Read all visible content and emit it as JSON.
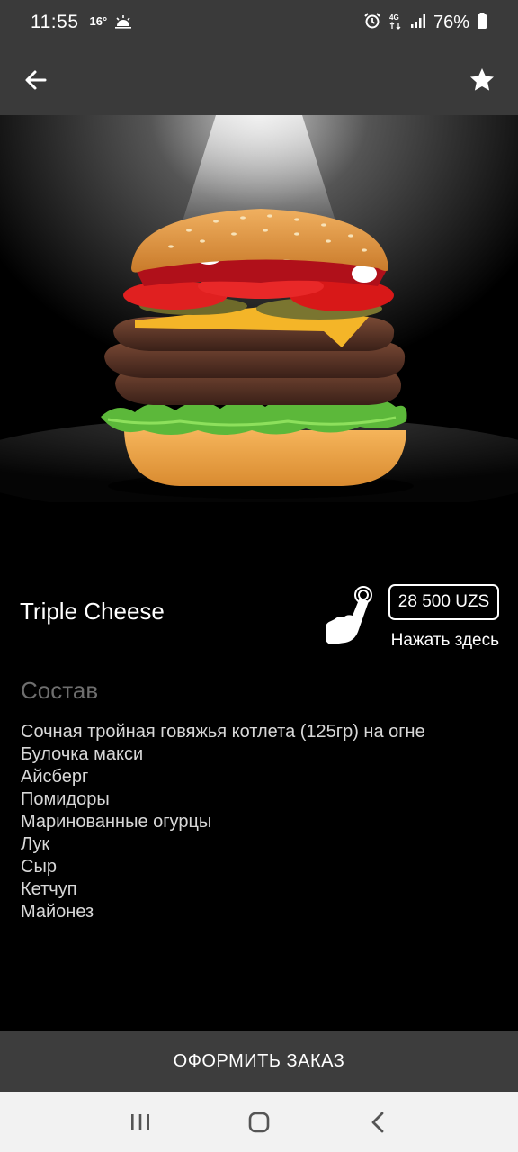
{
  "status_bar": {
    "time": "11:55",
    "temperature": "16°",
    "battery": "76%",
    "icons": [
      "weather-icon",
      "alarm-icon",
      "4g-icon",
      "signal-icon",
      "battery-icon"
    ]
  },
  "app_bar": {
    "back_icon": "arrow-left-icon",
    "favorite_icon": "star-icon"
  },
  "product": {
    "name": "Triple Cheese",
    "price": "28 500 UZS",
    "hint": "Нажать здесь"
  },
  "ingredients": {
    "title": "Состав",
    "items": [
      "Сочная тройная говяжья котлета (125гр) на огне",
      "Булочка макси",
      "Айсберг",
      "Помидоры",
      "Маринованные огурцы",
      "Лук",
      "Сыр",
      "Кетчуп",
      "Майонез"
    ]
  },
  "order_button": "ОФОРМИТЬ ЗАКАЗ",
  "nav_bar": {
    "icons": [
      "recent-apps-icon",
      "home-icon",
      "back-icon"
    ]
  },
  "colors": {
    "bar_background": "#3a3a3a",
    "page_background": "#000000",
    "section_title": "#6e6e6e"
  }
}
